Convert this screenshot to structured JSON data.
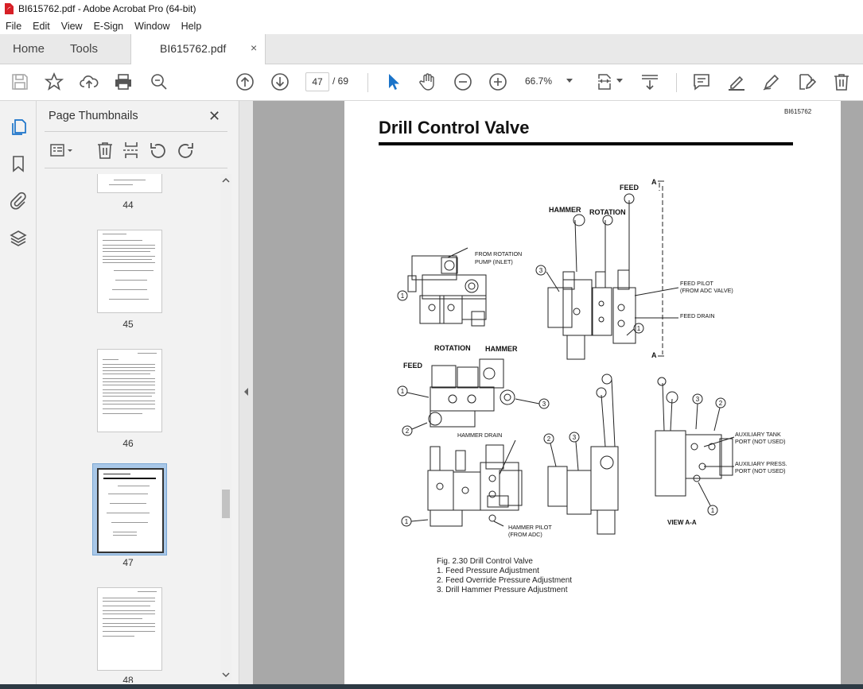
{
  "window": {
    "title": "BI615762.pdf - Adobe Acrobat Pro (64-bit)"
  },
  "menu": [
    "File",
    "Edit",
    "View",
    "E-Sign",
    "Window",
    "Help"
  ],
  "tabs": {
    "home": "Home",
    "tools": "Tools",
    "document": "BI615762.pdf",
    "close": "×"
  },
  "toolbar": {
    "current_page": "47",
    "total_pages": "/ 69",
    "zoom": "66.7%"
  },
  "panel": {
    "title": "Page Thumbnails",
    "close": "✕",
    "thumbnails": [
      {
        "label": "44"
      },
      {
        "label": "45"
      },
      {
        "label": "46"
      },
      {
        "label": "47",
        "selected": true
      },
      {
        "label": "48"
      }
    ]
  },
  "document": {
    "doc_id": "BI615762",
    "title": "Drill Control Valve",
    "labels": {
      "feed": "FEED",
      "hammer": "HAMMER",
      "rotation": "ROTATION",
      "from_rotation_pump": "FROM ROTATION",
      "pump_inlet": "PUMP (INLET)",
      "feed_pilot": "FEED PILOT",
      "from_adc_valve": "(FROM ADC VALVE)",
      "feed_drain": "FEED DRAIN",
      "a": "A",
      "hammer_drain": "HAMMER DRAIN",
      "hammer_pilot": "HAMMER PILOT",
      "from_adc": "(FROM ADC)",
      "aux_tank": "AUXILIARY TANK",
      "aux_press": "AUXILIARY PRESS.",
      "port_not_used": "PORT (NOT USED)",
      "view_aa": "VIEW A-A"
    },
    "caption": {
      "figure": "Fig. 2.30  Drill Control Valve",
      "items": [
        "1.  Feed Pressure Adjustment",
        "2.  Feed Override Pressure Adjustment",
        "3.  Drill Hammer Pressure Adjustment"
      ]
    }
  }
}
